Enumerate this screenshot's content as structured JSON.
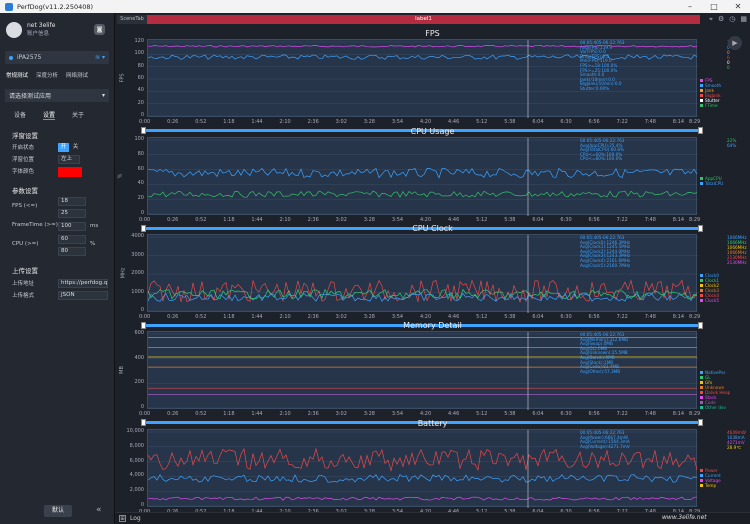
{
  "window": {
    "title": "PerfDog(v11.2.250408)"
  },
  "sidebar": {
    "user_name": "net 3elife",
    "user_sub": "账户信息",
    "device": "iPA2575",
    "top_tabs": [
      "常规测试",
      "深度分析",
      "网络测试"
    ],
    "app_select": "请选择测试应用",
    "sub_tabs": [
      "设备",
      "设置",
      "关于"
    ],
    "float": {
      "title": "浮窗设置",
      "switch_label": "开启状态",
      "on": "开",
      "off": "关",
      "pos_label": "浮窗位置",
      "pos_value": "左上",
      "color_label": "字体颜色",
      "color": "#ff0000"
    },
    "params": {
      "title": "参数设置",
      "rows": [
        {
          "label": "FPS (<=)",
          "v1": "18",
          "v2": "25",
          "unit": ""
        },
        {
          "label": "FrameTime (>=)",
          "v1": "100",
          "v2": "",
          "unit": "ms"
        },
        {
          "label": "CPU (>=)",
          "v1": "60",
          "v2": "80",
          "unit": "%"
        }
      ]
    },
    "upload": {
      "title": "上传设置",
      "addr_label": "上传地址",
      "addr_value": "https://perfdog.q",
      "fmt_label": "上传格式",
      "fmt_value": "JSON"
    },
    "default_btn": "默认"
  },
  "main": {
    "scene_tab": "SceneTab",
    "label_tab": "label1",
    "log_label": "Log",
    "watermark": "www.3elife.net"
  },
  "x_ticks": [
    "0:00",
    "0:26",
    "0:52",
    "1:18",
    "1:44",
    "2:10",
    "2:36",
    "3:02",
    "3:28",
    "3:54",
    "4:20",
    "4:46",
    "5:12",
    "5:38",
    "6:04",
    "6:30",
    "6:56",
    "7:22",
    "7:48",
    "8:14",
    "8:29"
  ],
  "charts": [
    {
      "title": "FPS",
      "unit": "FPS",
      "yticks": [
        "120",
        "100",
        "80",
        "60",
        "40",
        "20",
        "0"
      ],
      "info": "00:05:405-06:22:763\nAvg(FPS):119.9\nVar(FPS):0.0\nDrop(FPS):0.0\nMin(FPS):119.0\nFPS>=18:100.0%\nFPS>=25:100.0%\nSmooth:0.0\nJank(/10min):0.0\nBigJank(/10min):0.0\nStutter:0.00%",
      "legend": [
        {
          "name": "FPS",
          "color": "#e04cf0"
        },
        {
          "name": "Smooth",
          "color": "#3ea2ff"
        },
        {
          "name": "Jank",
          "color": "#e8a23b"
        },
        {
          "name": "BigJank",
          "color": "#e84a4a"
        },
        {
          "name": "Stutter",
          "color": "#fff"
        },
        {
          "name": "FTime",
          "color": "#37c06a"
        }
      ],
      "values": [
        "115.4",
        "0",
        "0",
        "0",
        "0",
        "0"
      ]
    },
    {
      "title": "CPU Usage",
      "unit": "%",
      "yticks": [
        "100",
        "80",
        "60",
        "40",
        "20",
        "0"
      ],
      "info": "00:05:405-06:22:763\nAvg(AppCPU):25.4%\nAvg(TotalCPU):60.8%\nCPU<=60%:100.0%\nCPU<=80%:100.0%",
      "legend": [
        {
          "name": "AppCPU",
          "color": "#37c06a"
        },
        {
          "name": "TotalCPU",
          "color": "#3ea2ff"
        }
      ],
      "values": [
        "22%",
        "64%"
      ]
    },
    {
      "title": "CPU Clock",
      "unit": "MHz",
      "yticks": [
        "4000",
        "3000",
        "2000",
        "1000",
        "0"
      ],
      "info": "00:05:405-06:22:763\nAvg(Clock0):1246.3MHz\nAvg(Clock1):1245.5MHz\nAvg(Clock2):1244.0MHz\nAvg(Clock3):1243.3MHz\nAvg(Clock4):2161.6MHz\nAvg(Clock5):2160.7MHz",
      "legend": [
        {
          "name": "Clock0",
          "color": "#3ea2ff"
        },
        {
          "name": "Clock1",
          "color": "#2ecc71"
        },
        {
          "name": "Clock2",
          "color": "#f1c40f"
        },
        {
          "name": "Clock3",
          "color": "#e67e22"
        },
        {
          "name": "Clock4",
          "color": "#e84a4a"
        },
        {
          "name": "Clock5",
          "color": "#e04cf0"
        }
      ],
      "values": [
        "1066MHz",
        "1066MHz",
        "1066MHz",
        "1066MHz",
        "2130MHz",
        "2130MHz"
      ]
    },
    {
      "title": "Memory Detail",
      "unit": "MB",
      "yticks": [
        "600",
        "400",
        "200",
        "0"
      ],
      "info": "00:05:405-06:22:763\nAvg(Memory):312.6MB\nAvg(Swap):0MB\nAvg(GL):0MB\nAvg(Unknown):25.5MB\nAvg(Dalvik):0MB\nAvg(Stack):1MB\nAvg(Code):83.4MB\nAvg(Other):57.3MB",
      "legend": [
        {
          "name": "NativePss",
          "color": "#3ea2ff"
        },
        {
          "name": "GL",
          "color": "#2ecc71"
        },
        {
          "name": "Gfx",
          "color": "#f1c40f"
        },
        {
          "name": "Unknown",
          "color": "#e67e22"
        },
        {
          "name": "Dalvik Heap",
          "color": "#e84a4a"
        },
        {
          "name": "Stack",
          "color": "#e04cf0"
        },
        {
          "name": "Code",
          "color": "#9b59b6"
        },
        {
          "name": "Other dev",
          "color": "#1abc9c"
        }
      ],
      "values": [
        "",
        "",
        "",
        "",
        "",
        "",
        "",
        ""
      ]
    },
    {
      "title": "Battery",
      "unit": "",
      "yticks": [
        "10,000",
        "8,000",
        "6,000",
        "4,000",
        "2,000",
        "0"
      ],
      "info": "00:05:405-06:22:763\nAvg(Power):6667.4mW\nAvg(Current):1564.3mA\nAvg(Voltage):4271.7mV",
      "legend": [
        {
          "name": "Power",
          "color": "#e84a4a"
        },
        {
          "name": "Current",
          "color": "#3ea2ff"
        },
        {
          "name": "Voltage",
          "color": "#e04cf0"
        },
        {
          "name": "Temp",
          "color": "#f1c40f"
        }
      ],
      "values": [
        "4649mW",
        "1038mA",
        "4271mV",
        "28.9℃"
      ]
    }
  ]
}
